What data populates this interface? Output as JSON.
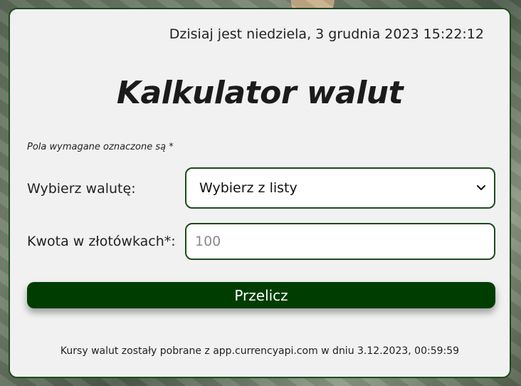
{
  "header": {
    "datetime": "Dzisiaj jest niedziela, 3 grudnia 2023 15:22:12"
  },
  "title": "Kalkulator walut",
  "required_note": "Pola wymagane oznaczone są *",
  "form": {
    "currency_label": "Wybierz walutę:",
    "currency_selected": "Wybierz z listy",
    "amount_label": "Kwota w złotówkach*:",
    "amount_placeholder": "100",
    "amount_value": ""
  },
  "button": {
    "label": "Przelicz"
  },
  "footer": {
    "source_text": "Kursy walut zostały pobrane z app.currencyapi.com w dniu 3.12.2023, 00:59:59"
  },
  "icons": {
    "select_arrow": "chevron-down-icon"
  },
  "colors": {
    "accent": "#003d00",
    "border": "#1c4b1c",
    "card_bg": "#f1f1f1"
  }
}
